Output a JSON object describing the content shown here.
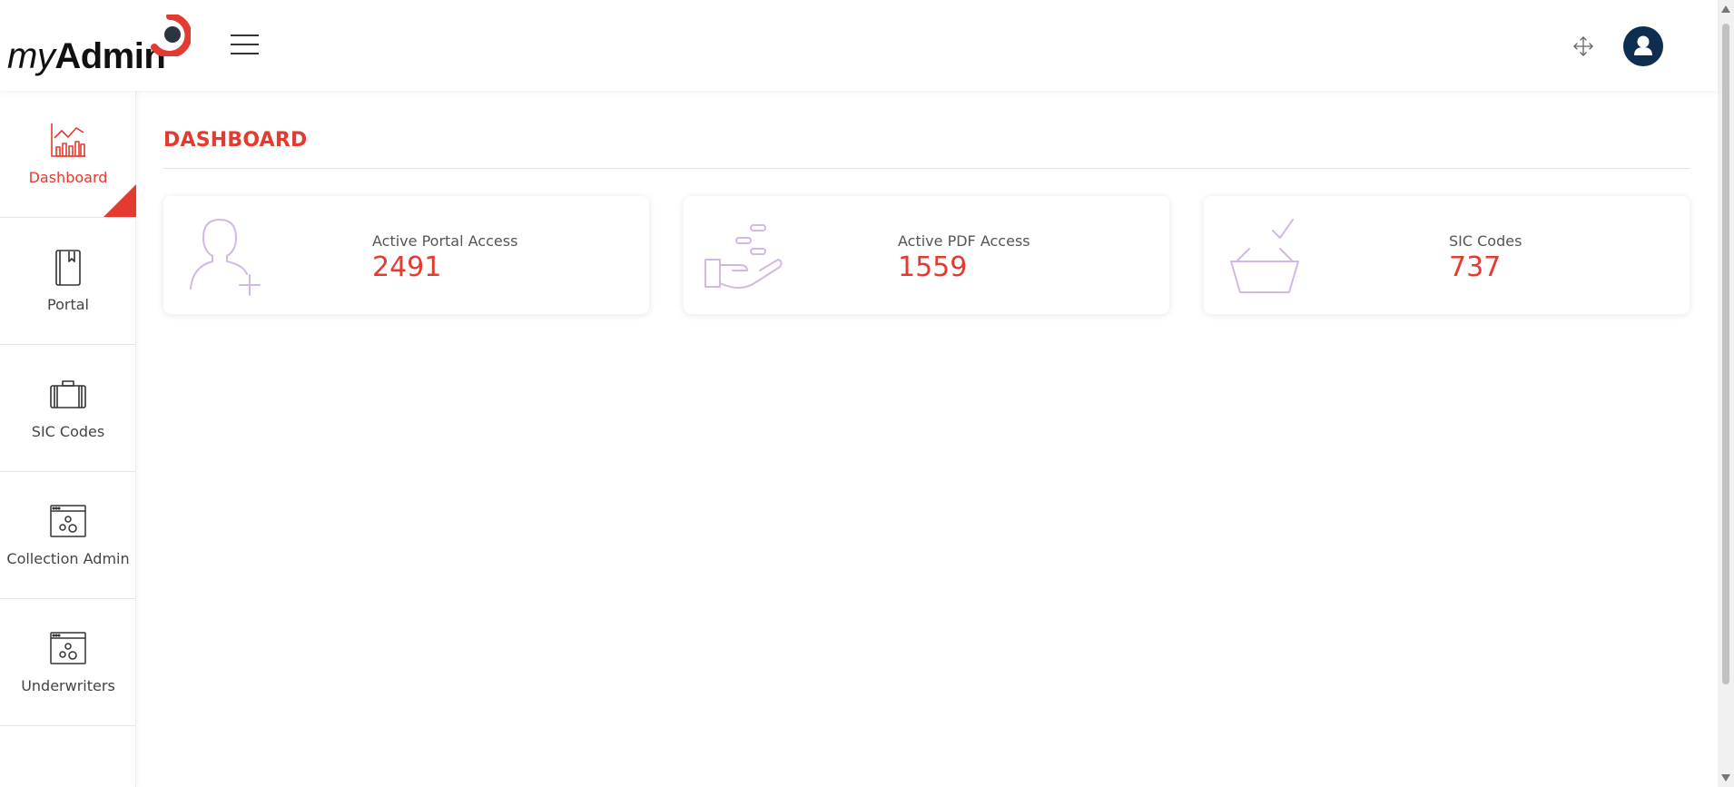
{
  "header": {
    "logo": {
      "my": "my",
      "admin": "Admin"
    },
    "menu_icon": "hamburger-icon",
    "fullscreen_icon": "expand-arrows-icon",
    "avatar_icon": "user-icon"
  },
  "sidebar": {
    "items": [
      {
        "label": "Dashboard",
        "icon": "chart-icon",
        "active": true
      },
      {
        "label": "Portal",
        "icon": "book-icon",
        "active": false
      },
      {
        "label": "SIC Codes",
        "icon": "briefcase-icon",
        "active": false
      },
      {
        "label": "Collection Admin",
        "icon": "window-gears-icon",
        "active": false
      },
      {
        "label": "Underwriters",
        "icon": "window-gears-icon",
        "active": false
      }
    ]
  },
  "main": {
    "title": "DASHBOARD",
    "cards": [
      {
        "label": "Active Portal Access",
        "value": "2491",
        "icon": "add-user-icon"
      },
      {
        "label": "Active PDF Access",
        "value": "1559",
        "icon": "hand-coins-icon"
      },
      {
        "label": "SIC Codes",
        "value": "737",
        "icon": "basket-check-icon"
      }
    ]
  },
  "colors": {
    "accent": "#e53a2f",
    "avatar_bg": "#0f2e4f",
    "card_icon": "#d2b8e4"
  }
}
